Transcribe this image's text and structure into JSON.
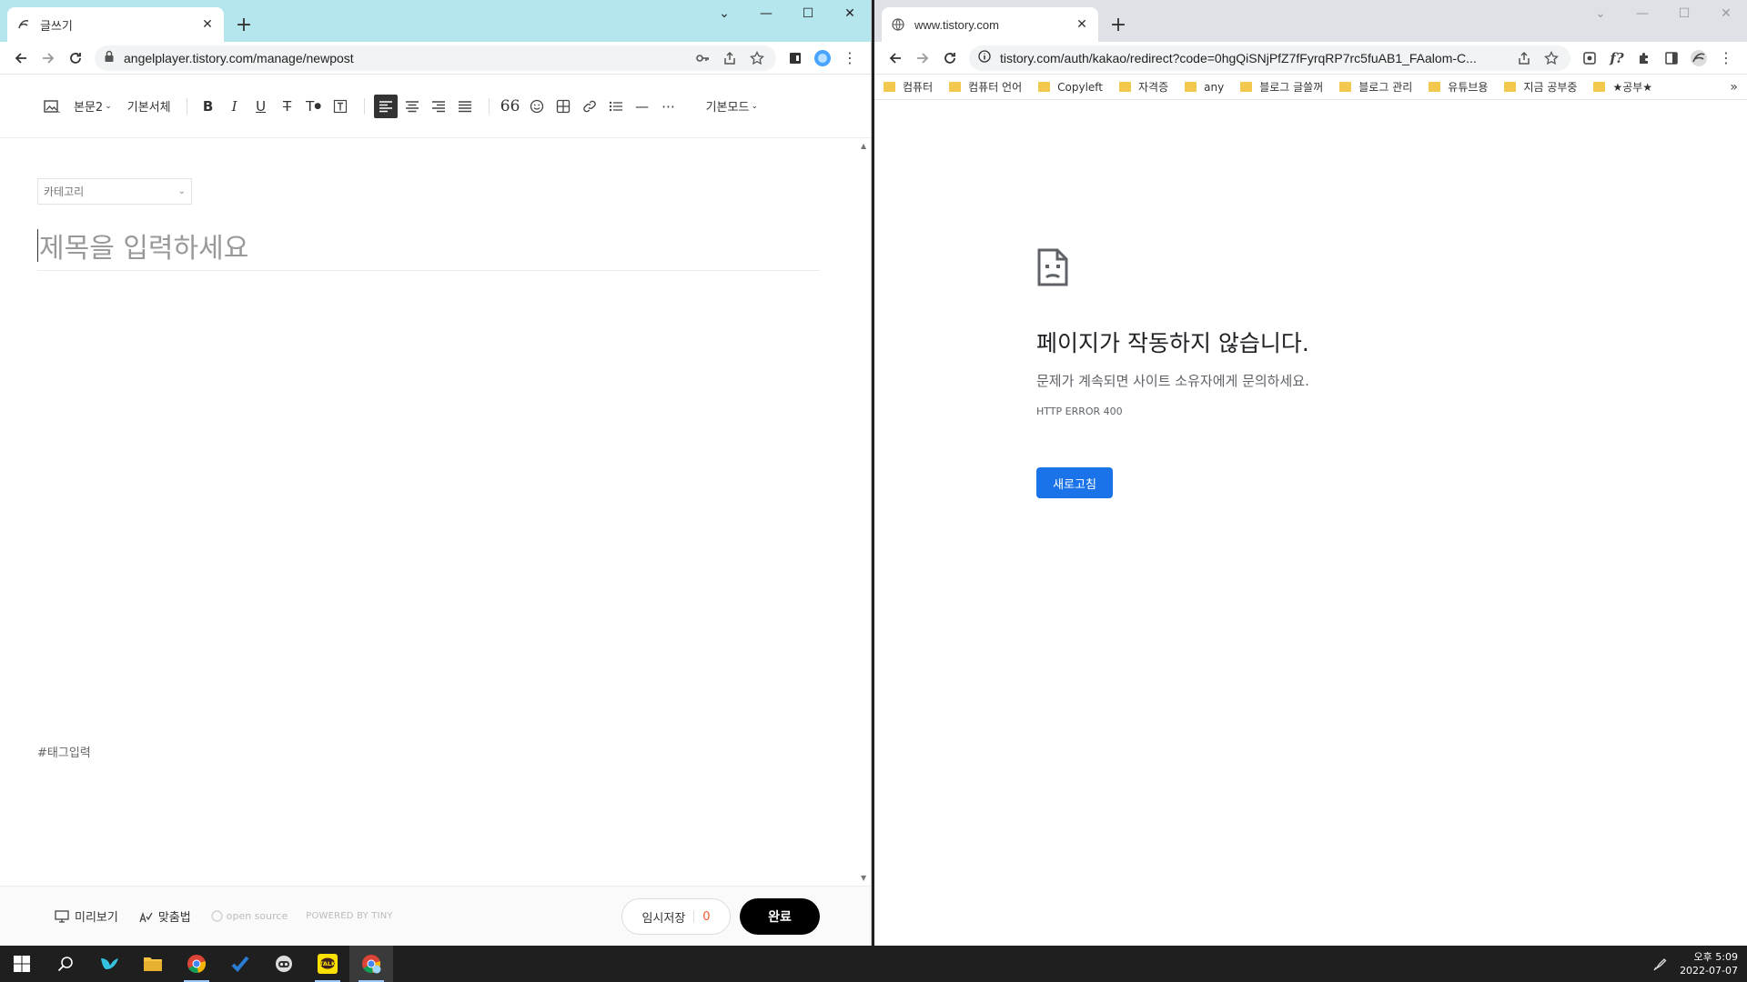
{
  "left_window": {
    "tab_title": "글쓰기",
    "url": "angelplayer.tistory.com/manage/newpost",
    "editor": {
      "toolbar": {
        "paragraph_style": "본문2",
        "font": "기본서체",
        "mode": "기본모드"
      },
      "category_placeholder": "카테고리",
      "title_placeholder": "제목을 입력하세요",
      "tag_placeholder": "#태그입력",
      "footer": {
        "preview": "미리보기",
        "spellcheck": "맞춤법",
        "open_source": "open source",
        "powered_by": "POWERED BY TINY",
        "draft_label": "임시저장",
        "draft_count": "0",
        "done_label": "완료"
      }
    }
  },
  "right_window": {
    "tab_title": "www.tistory.com",
    "url": "tistory.com/auth/kakao/redirect?code=0hgQiSNjPfZ7fFyrqRP7rc5fuAB1_FAalom-C...",
    "bookmarks": [
      "컴퓨터",
      "컴퓨터 언어",
      "Copyleft",
      "자격증",
      "any",
      "블로그 글쓸꺼",
      "블로그 관리",
      "유튜브용",
      "지금 공부중",
      "★공부★"
    ],
    "error": {
      "title": "페이지가 작동하지 않습니다.",
      "description": "문제가 계속되면 사이트 소유자에게 문의하세요.",
      "code": "HTTP ERROR 400",
      "reload_label": "새로고침"
    }
  },
  "taskbar": {
    "clock_period_time": "오후 5:09",
    "clock_date": "2022-07-07"
  },
  "colors": {
    "left_tabstrip": "#b5e6ee",
    "right_tabstrip": "#dee1e6",
    "reload_button": "#1a73e8",
    "draft_count": "#f5582e",
    "taskbar": "#1f1f1f"
  }
}
